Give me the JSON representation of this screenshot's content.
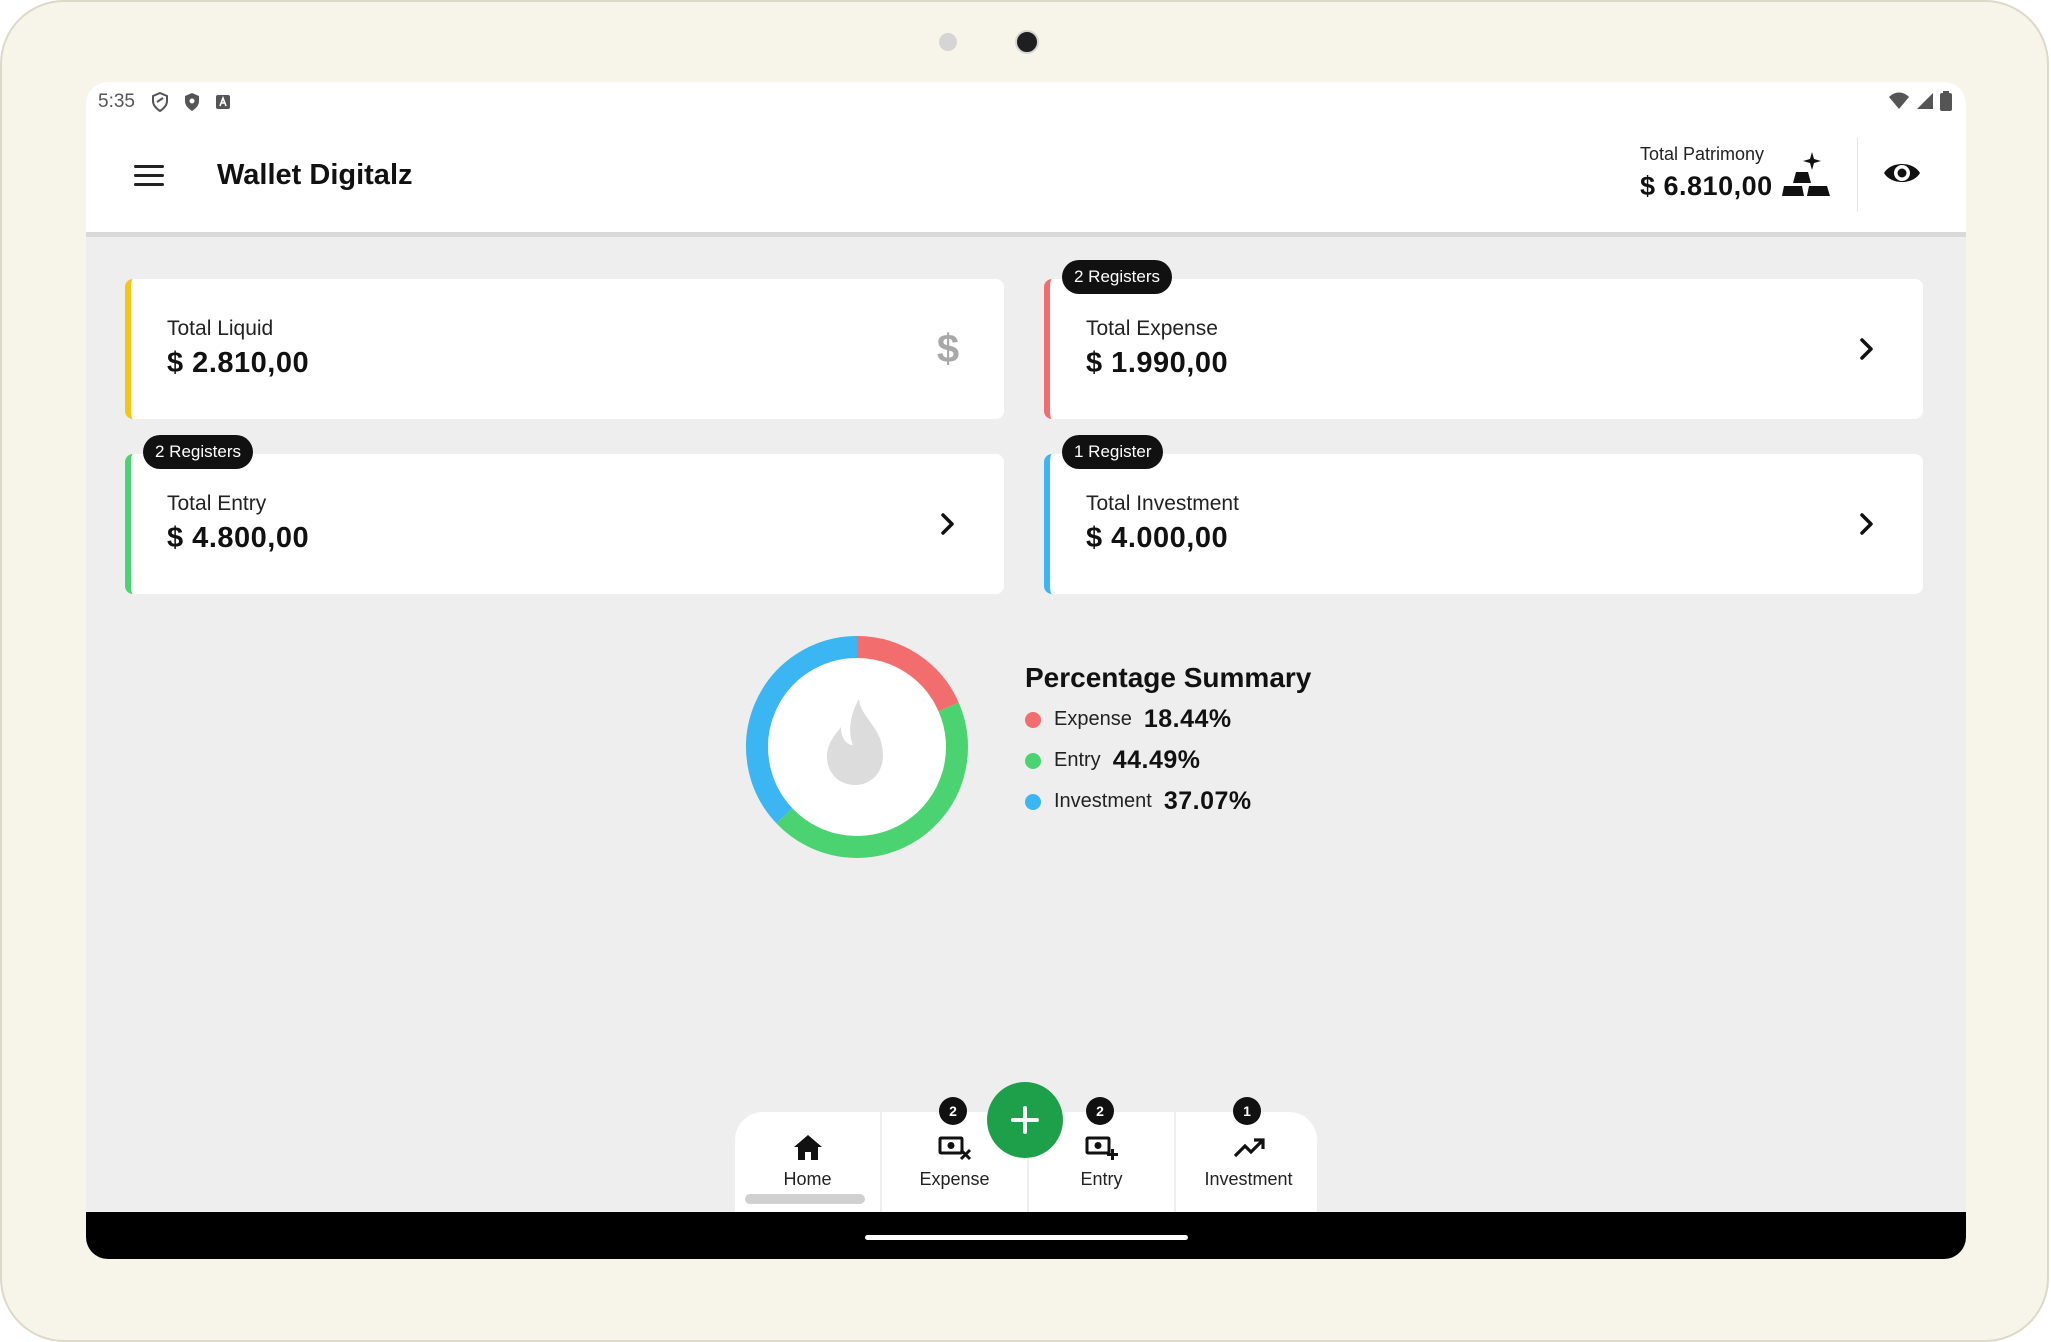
{
  "status_bar": {
    "time": "5:35"
  },
  "app_bar": {
    "title": "Wallet Digitalz",
    "patrimony_label": "Total Patrimony",
    "patrimony_value": "$ 6.810,00"
  },
  "cards": {
    "liquid": {
      "label": "Total Liquid",
      "value": "$ 2.810,00"
    },
    "expense": {
      "label": "Total Expense",
      "value": "$ 1.990,00",
      "badge": "2 Registers"
    },
    "entry": {
      "label": "Total Entry",
      "value": "$ 4.800,00",
      "badge": "2 Registers"
    },
    "investment": {
      "label": "Total Investment",
      "value": "$ 4.000,00",
      "badge": "1 Register"
    }
  },
  "summary": {
    "title": "Percentage Summary",
    "items": [
      {
        "name": "Expense",
        "pct": "18.44%",
        "value": 18.44,
        "color": "#f26d6d"
      },
      {
        "name": "Entry",
        "pct": "44.49%",
        "value": 44.49,
        "color": "#4bd372"
      },
      {
        "name": "Investment",
        "pct": "37.07%",
        "value": 37.07,
        "color": "#3bb6f3"
      }
    ]
  },
  "bottom_nav": {
    "home": {
      "label": "Home"
    },
    "expense": {
      "label": "Expense",
      "badge": "2"
    },
    "entry": {
      "label": "Entry",
      "badge": "2"
    },
    "investment": {
      "label": "Investment",
      "badge": "1"
    }
  },
  "icons": {
    "menu": "menu-icon",
    "gold": "gold-bars-icon",
    "eye": "eye-icon",
    "dollar": "dollar-icon",
    "chevron": "chevron-right-icon",
    "flame": "flame-icon",
    "home": "home-icon",
    "expense": "money-remove-icon",
    "entry": "money-add-icon",
    "investment": "trending-up-icon",
    "add": "plus-icon"
  },
  "colors": {
    "accent_green": "#1ea04b",
    "liquid": "#f5c518",
    "expense": "#f26d6d",
    "entry": "#4bd372",
    "investment": "#3bb6f3"
  }
}
